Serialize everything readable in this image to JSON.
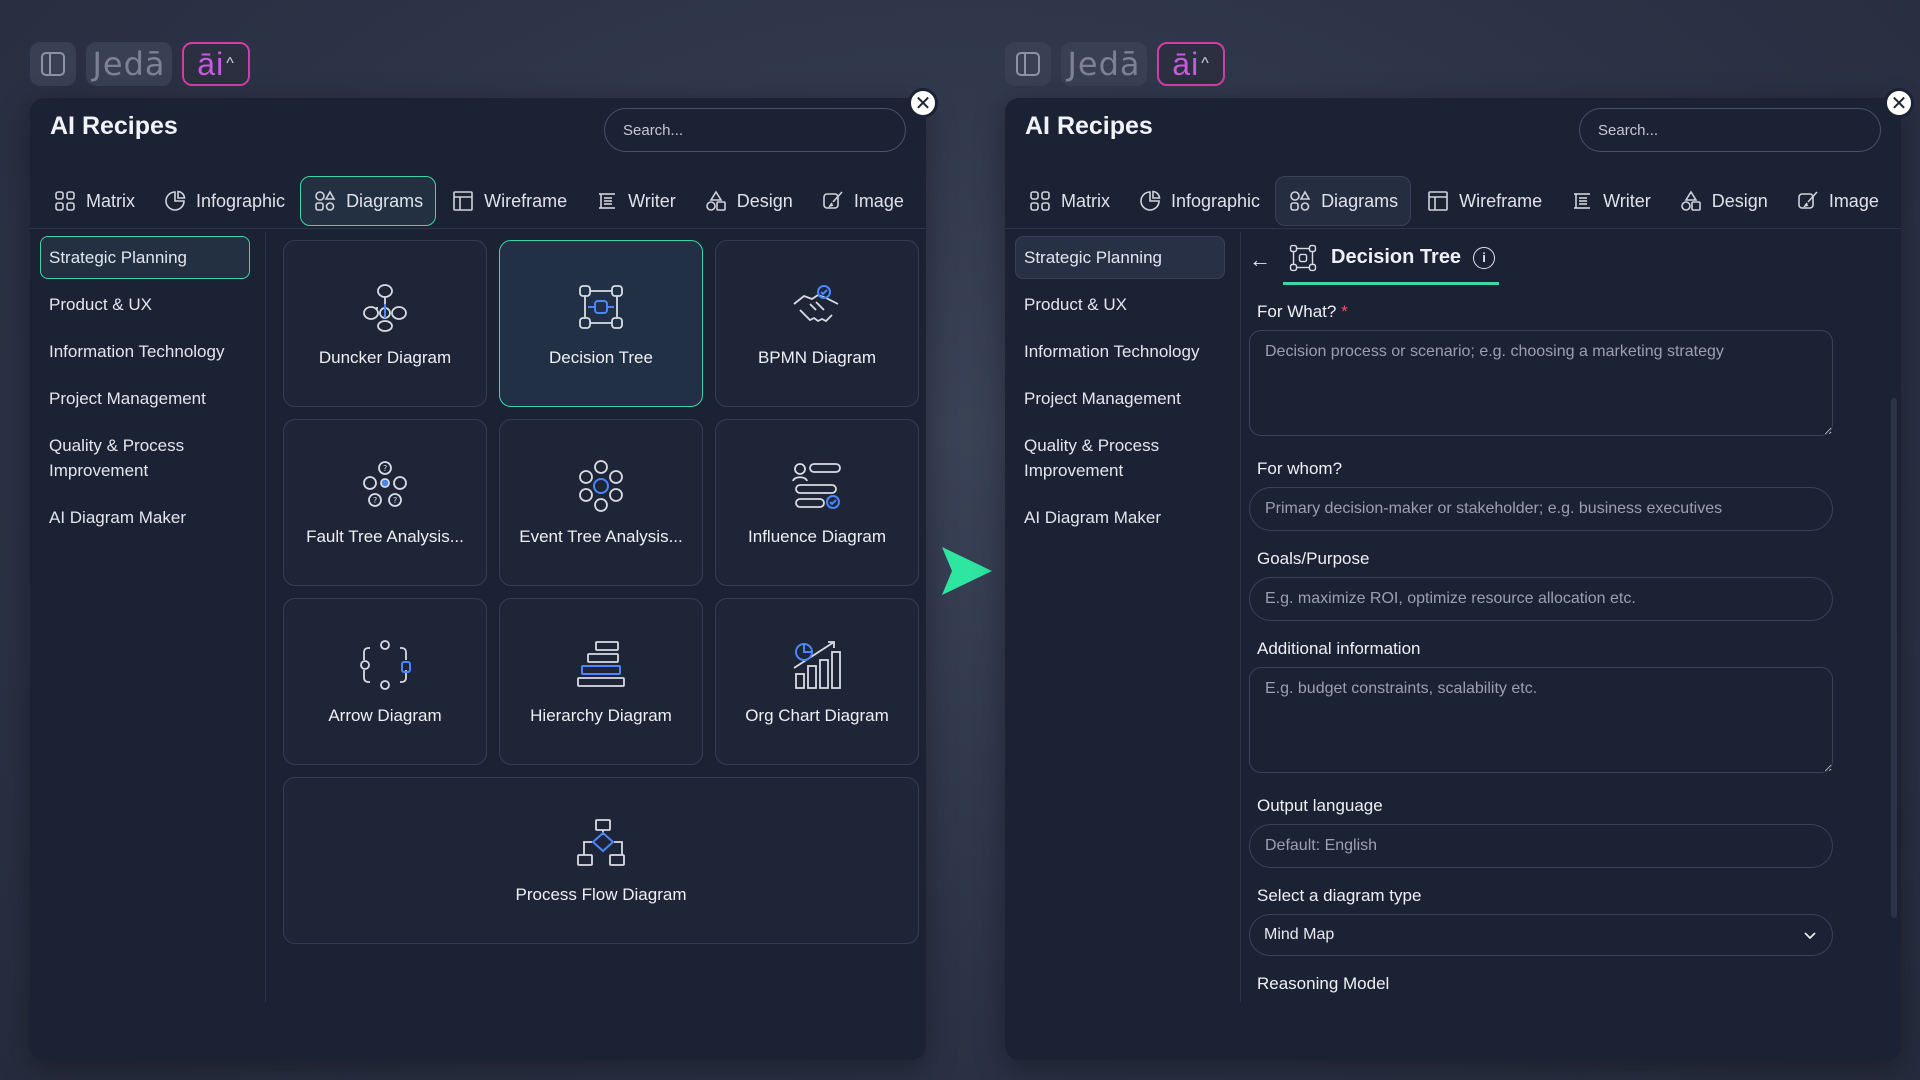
{
  "toolbar": {
    "brand": "Jedā",
    "ai_label": "āi",
    "caret": "^"
  },
  "panel_left": {
    "title": "AI Recipes",
    "search_placeholder": "Search...",
    "tabs": [
      "Matrix",
      "Infographic",
      "Diagrams",
      "Wireframe",
      "Writer",
      "Design",
      "Image"
    ],
    "active_tab": "Diagrams",
    "sidebar": [
      "Strategic Planning",
      "Product & UX",
      "Information Technology",
      "Project Management",
      "Quality & Process Improvement",
      "AI Diagram Maker"
    ],
    "selected_sidebar": "Strategic Planning",
    "cards": [
      {
        "label": "Duncker Diagram",
        "icon": "duncker-icon"
      },
      {
        "label": "Decision Tree",
        "icon": "decision-tree-icon"
      },
      {
        "label": "BPMN Diagram",
        "icon": "handshake-icon"
      },
      {
        "label": "Fault Tree Analysis...",
        "icon": "fault-tree-icon"
      },
      {
        "label": "Event Tree Analysis...",
        "icon": "event-tree-icon"
      },
      {
        "label": "Influence Diagram",
        "icon": "influence-icon"
      },
      {
        "label": "Arrow Diagram",
        "icon": "arrow-diagram-icon"
      },
      {
        "label": "Hierarchy Diagram",
        "icon": "hierarchy-icon"
      },
      {
        "label": "Org Chart Diagram",
        "icon": "org-chart-icon"
      },
      {
        "label": "Process Flow Diagram",
        "icon": "process-flow-icon"
      }
    ],
    "selected_card": "Decision Tree"
  },
  "panel_right": {
    "title": "AI Recipes",
    "search_placeholder": "Search...",
    "tabs": [
      "Matrix",
      "Infographic",
      "Diagrams",
      "Wireframe",
      "Writer",
      "Design",
      "Image"
    ],
    "active_tab": "Diagrams",
    "sidebar": [
      "Strategic Planning",
      "Product & UX",
      "Information Technology",
      "Project Management",
      "Quality & Process Improvement",
      "AI Diagram Maker"
    ],
    "selected_sidebar": "Strategic Planning",
    "form": {
      "back": "←",
      "title": "Decision Tree",
      "info": "i",
      "for_what_label": "For What?",
      "required_mark": "*",
      "for_what_placeholder": "Decision process or scenario; e.g. choosing a marketing strategy",
      "for_whom_label": "For whom?",
      "for_whom_placeholder": "Primary decision-maker or stakeholder; e.g. business executives",
      "goals_label": "Goals/Purpose",
      "goals_placeholder": "E.g. maximize ROI, optimize resource allocation etc.",
      "additional_label": "Additional information",
      "additional_placeholder": "E.g. budget constraints, scalability etc.",
      "output_language_label": "Output language",
      "output_language_placeholder": "Default: English",
      "diagram_type_label": "Select a diagram type",
      "diagram_type_value": "Mind Map",
      "reasoning_label": "Reasoning Model"
    }
  },
  "colors": {
    "accent": "#3dd6a6",
    "ai_border": "#d23ca6",
    "panel_bg": "#1b2234",
    "page_bg": "#2c3346"
  }
}
